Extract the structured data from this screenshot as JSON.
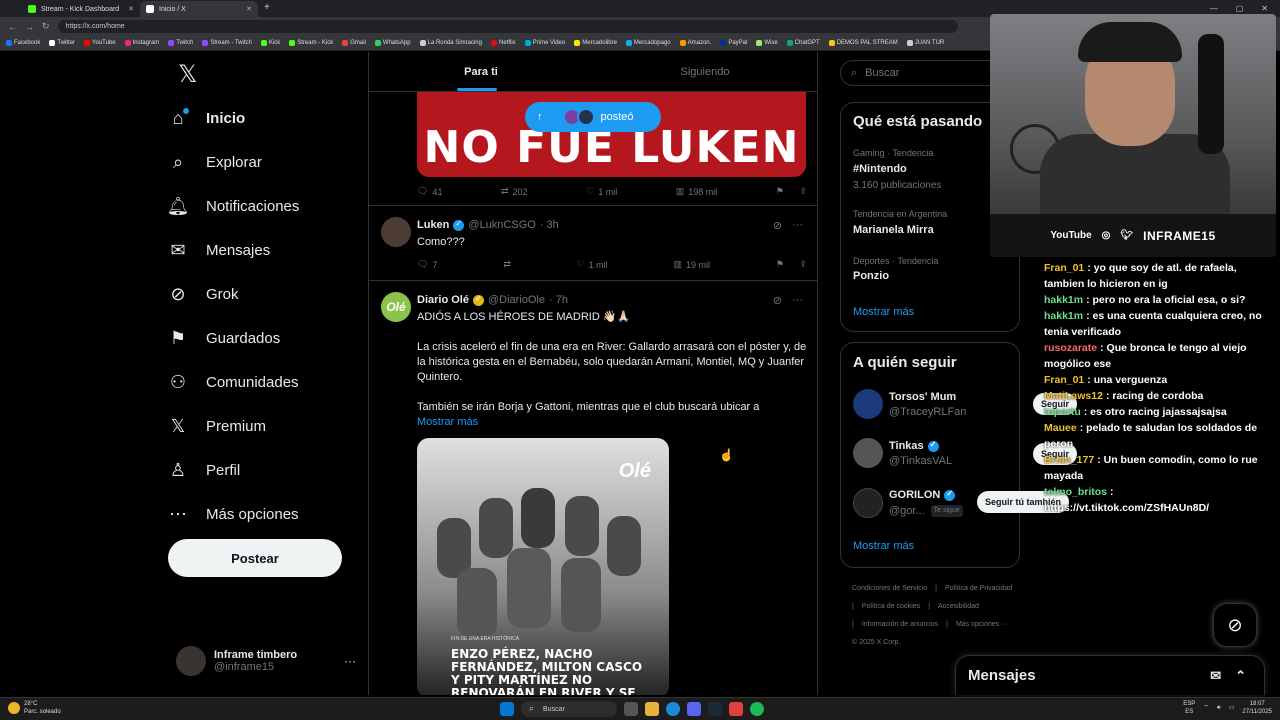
{
  "browser": {
    "tabs": [
      {
        "label": "Stream - Kick Dashboard",
        "color": "#53fc18"
      },
      {
        "label": "Inicio / X",
        "color": "#ffffff"
      }
    ],
    "new_tab": "+",
    "url": "https://x.com/home",
    "bookmarks": [
      "Facebook",
      "Twitter",
      "YouTube",
      "Instagram",
      "Twitch",
      "Stream - Twitch",
      "Kick",
      "Stream - Kick",
      "Gmail",
      "WhatsApp",
      "La Ronda Simracing",
      "Netflix",
      "Prime Video",
      "Mercadolibre",
      "Mercadopago",
      "Amazon.",
      "PayPal",
      "Wise",
      "ChatGPT",
      "DEMOS PAL STREAM",
      "JUAN TUR"
    ]
  },
  "nav": {
    "logo": "𝕏",
    "items": [
      {
        "label": "Inicio",
        "icon": "home-icon",
        "glyph": "⌂"
      },
      {
        "label": "Explorar",
        "icon": "search-icon",
        "glyph": "⌕"
      },
      {
        "label": "Notificaciones",
        "icon": "bell-icon",
        "glyph": "🔔︎"
      },
      {
        "label": "Mensajes",
        "icon": "envelope-icon",
        "glyph": "✉"
      },
      {
        "label": "Grok",
        "icon": "grok-icon",
        "glyph": "⊘"
      },
      {
        "label": "Guardados",
        "icon": "bookmark-icon",
        "glyph": "⚑"
      },
      {
        "label": "Comunidades",
        "icon": "communities-icon",
        "glyph": "⚇"
      },
      {
        "label": "Premium",
        "icon": "x-premium-icon",
        "glyph": "𝕏"
      },
      {
        "label": "Perfil",
        "icon": "person-icon",
        "glyph": "♙"
      },
      {
        "label": "Más opciones",
        "icon": "more-circle-icon",
        "glyph": "⋯"
      }
    ],
    "post_button": "Postear",
    "profile": {
      "name": "Inframe timbero",
      "handle": "@inframe15",
      "more": "···"
    }
  },
  "feed": {
    "tabs": [
      "Para ti",
      "Siguiendo"
    ],
    "banner_text": "NO FUE LUKEN",
    "posted_pill": "posteó",
    "tweet1_actions": {
      "replies": "41",
      "retweets": "202",
      "likes": "1 mil",
      "views": "198 mil"
    },
    "tweet2": {
      "name": "Luken",
      "handle": "@LuknCSGO",
      "time": "· 3h",
      "text": "Como???",
      "actions": {
        "replies": "7",
        "retweets": "",
        "likes": "1 mil",
        "views": "19 mil"
      }
    },
    "tweet3": {
      "name": "Diario Olé",
      "handle": "@DiarioOle",
      "time": "· 7h",
      "headline": "ADIÓS A LOS HÉROES DE MADRID 👋🏻🙏🏻",
      "paragraph1": "La crisis aceleró el fin de una era en River: Gallardo arrasará con el póster y, de la histórica gesta en el Bernabéu, solo quedarán Armani, Montiel, MQ y Juanfer Quintero.",
      "paragraph2": "También se irán Borja y Gattoni, mientras que el club buscará ubicar a",
      "show_more": "Mostrar más",
      "media_logo": "Olé",
      "media_tag": "FIN DE UNA ERA HISTÓRICA",
      "media_headline": "ENZO PÉREZ, NACHO FERNÁNDEZ, MILTON CASCO Y PITY MARTÍNEZ NO RENOVARÁN EN RIVER Y SE VAN"
    }
  },
  "sidebar": {
    "search_placeholder": "Buscar",
    "trends_title": "Qué está pasando",
    "trends": [
      {
        "context": "Gaming · Tendencia",
        "name": "#Nintendo",
        "count": "3.160 publicaciones"
      },
      {
        "context": "Tendencia en Argentina",
        "name": "Marianela Mirra",
        "count": ""
      },
      {
        "context": "Deportes · Tendencia",
        "name": "Ponzio",
        "count": ""
      }
    ],
    "show_more": "Mostrar más",
    "follow_title": "A quién seguir",
    "follow": [
      {
        "name": "Torsos' Mum",
        "handle": "@TraceyRLFan",
        "button": "Seguir",
        "verified": false
      },
      {
        "name": "Tinkas",
        "handle": "@TinkasVAL",
        "button": "Seguir",
        "verified": true
      },
      {
        "name": "GORILON",
        "handle": "@gor...",
        "badge": "Te sigue",
        "button": "Seguir tú también",
        "verified": true
      }
    ],
    "follow_more": "Mostrar más",
    "footer": [
      "Condiciones de Servicio",
      "|",
      "Política de Privacidad",
      "|",
      "Política de cookies",
      "|",
      "Accesibilidad",
      "|",
      "Información de anuncios",
      "|",
      "Más opciones ···",
      "© 2025 X Corp."
    ],
    "messages_title": "Mensajes"
  },
  "stream": {
    "socials": [
      "YouTube",
      "◎",
      "🐦︎",
      "INFRAME15"
    ],
    "chat": [
      {
        "user": "Fran_01",
        "color": "#f0c030",
        "msg": ": yo que soy de atl. de rafaela, tambien lo hicieron en ig"
      },
      {
        "user": "hakk1m",
        "color": "#6ce08a",
        "msg": ": pero no era la oficial esa, o si?"
      },
      {
        "user": "hakk1m",
        "color": "#6ce08a",
        "msg": ": es una cuenta cualquiera creo, no tenia verificado"
      },
      {
        "user": "rusozarate",
        "color": "#ff6a6a",
        "msg": ": Que bronca le tengo al viejo mogólico ese"
      },
      {
        "user": "Fran_01",
        "color": "#f0c030",
        "msg": ": una verguenza"
      },
      {
        "user": "MatiLaws12",
        "color": "#f0c030",
        "msg": ": racing de cordoba"
      },
      {
        "user": "toportu",
        "color": "#6ce08a",
        "msg": ": es otro racing jajassajsajsa"
      },
      {
        "user": "Mauee",
        "color": "#f0c030",
        "msg": ": pelado te saludan los soldados de peron"
      },
      {
        "user": "Brian_177",
        "color": "#f0c030",
        "msg": ": Un buen comodin, como lo rue mayada"
      },
      {
        "user": "telmo_britos",
        "color": "#6ce08a",
        "msg": ": https://vt.tiktok.com/ZSfHAUn8D/"
      }
    ]
  },
  "taskbar": {
    "weather_temp": "28°C",
    "weather_desc": "Parc. soleado",
    "search": "Buscar",
    "lang": "ESP",
    "lang2": "ES",
    "time": "18:07",
    "date": "27/11/2025"
  },
  "colors": {
    "accent": "#1d9bf0",
    "banner": "#b4181e",
    "kick": "#53fc18"
  }
}
